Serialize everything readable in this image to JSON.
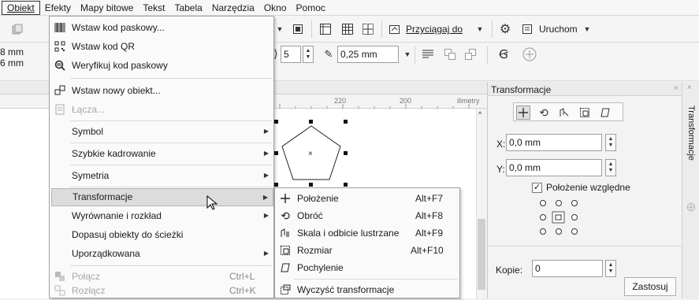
{
  "menubar": {
    "items": [
      "Obiekt",
      "Efekty",
      "Mapy bitowe",
      "Tekst",
      "Tabela",
      "Narzędzia",
      "Okno",
      "Pomoc"
    ]
  },
  "toolbar": {
    "snap_label": "Przyciągaj do",
    "launch_label": "Uruchom"
  },
  "propertybar": {
    "size_w": "8 mm",
    "size_h": "6 mm",
    "sides_value": "5",
    "outline_value": "0,25 mm"
  },
  "ruler": {
    "ticks": [
      "220",
      "200"
    ],
    "unit": "ilimetry"
  },
  "object_menu": {
    "items": [
      {
        "label": "Wstaw kod paskowy...",
        "icon": "barcode-icon"
      },
      {
        "label": "Wstaw kod QR",
        "icon": "qr-code-icon"
      },
      {
        "label": "Weryfikuj kod paskowy",
        "icon": "verify-barcode-icon"
      },
      {
        "label": "Wstaw nowy obiekt...",
        "icon": "insert-object-icon"
      },
      {
        "label": "Łącza...",
        "icon": "links-icon"
      },
      {
        "label": "Symbol"
      },
      {
        "label": "Szybkie kadrowanie"
      },
      {
        "label": "Symetria"
      },
      {
        "label": "Transformacje"
      },
      {
        "label": "Wyrównanie i rozkład"
      },
      {
        "label": "Dopasuj obiekty do ścieżki"
      },
      {
        "label": "Uporządkowana"
      },
      {
        "label": "Połącz",
        "shortcut": "Ctrl+L"
      },
      {
        "label": "Rozłącz",
        "shortcut": "Ctrl+K"
      }
    ]
  },
  "transform_submenu": {
    "items": [
      {
        "label": "Położenie",
        "shortcut": "Alt+F7"
      },
      {
        "label": "Obróć",
        "shortcut": "Alt+F8"
      },
      {
        "label": "Skala i odbicie lustrzane",
        "shortcut": "Alt+F9"
      },
      {
        "label": "Rozmiar",
        "shortcut": "Alt+F10"
      },
      {
        "label": "Pochylenie",
        "shortcut": ""
      },
      {
        "label": "Wyczyść transformacje",
        "shortcut": ""
      }
    ]
  },
  "docker": {
    "title": "Transformacje",
    "tab_label": "Transformacje",
    "x_label": "X:",
    "x_value": "0,0 mm",
    "y_label": "Y:",
    "y_value": "0,0 mm",
    "relative_label": "Położenie względne",
    "relative_checked": true,
    "copies_label": "Kopie:",
    "copies_value": "0",
    "apply_label": "Zastosuj"
  }
}
